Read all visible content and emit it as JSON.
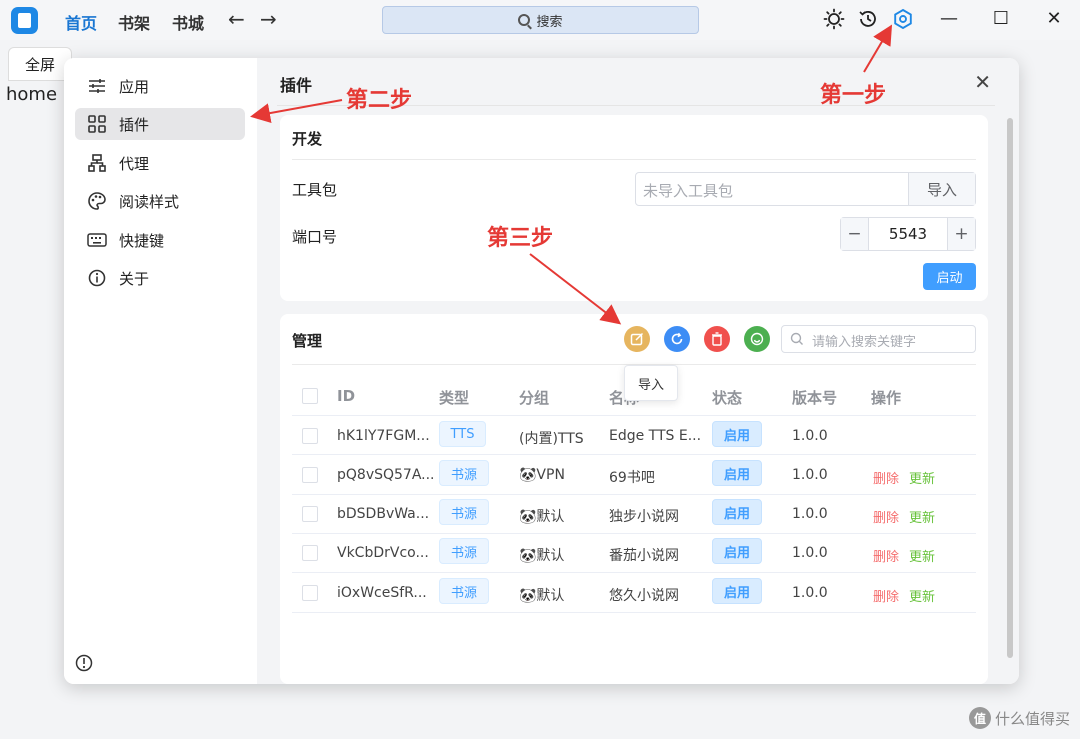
{
  "topbar": {
    "nav": [
      "首页",
      "书架",
      "书城"
    ],
    "back_arrow": "←",
    "forward_arrow": "→",
    "search_label": "搜索",
    "minimize": "—",
    "maximize": "☐",
    "close": "✕"
  },
  "background": {
    "tab_label": "全屏",
    "home_text": "home"
  },
  "sidebar": {
    "items": [
      {
        "label": "应用",
        "icon": "sliders-icon"
      },
      {
        "label": "插件",
        "icon": "grid-icon"
      },
      {
        "label": "代理",
        "icon": "network-icon"
      },
      {
        "label": "阅读样式",
        "icon": "palette-icon"
      },
      {
        "label": "快捷键",
        "icon": "keyboard-icon"
      },
      {
        "label": "关于",
        "icon": "info-icon"
      }
    ],
    "active_index": 1
  },
  "content": {
    "title": "插件",
    "close": "✕"
  },
  "dev_card": {
    "title": "开发",
    "toolkit_label": "工具包",
    "toolkit_placeholder": "未导入工具包",
    "import_button": "导入",
    "port_label": "端口号",
    "port_value": "5543",
    "minus": "−",
    "plus": "+",
    "start_button": "启动"
  },
  "manage_card": {
    "title": "管理",
    "search_placeholder": "请输入搜索关键字",
    "tooltip": "导入",
    "action_colors": [
      "#e6b55f",
      "#3d8df5",
      "#f0504d",
      "#4caf50"
    ],
    "columns": [
      "ID",
      "类型",
      "分组",
      "名称",
      "状态",
      "版本号",
      "操作"
    ],
    "rows": [
      {
        "id": "hK1lY7FGM...",
        "type": "TTS",
        "group": "(内置)TTS",
        "name": "Edge TTS E...",
        "status": "启用",
        "version": "1.0.0",
        "delete": "",
        "update": ""
      },
      {
        "id": "pQ8vSQ57A...",
        "type": "书源",
        "group": "🐼VPN",
        "name": "69书吧",
        "status": "启用",
        "version": "1.0.0",
        "delete": "删除",
        "update": "更新"
      },
      {
        "id": "bDSDBvWa...",
        "type": "书源",
        "group": "🐼默认",
        "name": "独步小说网",
        "status": "启用",
        "version": "1.0.0",
        "delete": "删除",
        "update": "更新"
      },
      {
        "id": "VkCbDrVco...",
        "type": "书源",
        "group": "🐼默认",
        "name": "番茄小说网",
        "status": "启用",
        "version": "1.0.0",
        "delete": "删除",
        "update": "更新"
      },
      {
        "id": "iOxWceSfR...",
        "type": "书源",
        "group": "🐼默认",
        "name": "悠久小说网",
        "status": "启用",
        "version": "1.0.0",
        "delete": "删除",
        "update": "更新"
      }
    ]
  },
  "annotations": {
    "step1": "第一步",
    "step2": "第二步",
    "step3": "第三步",
    "color": "#e53935"
  },
  "watermark": {
    "badge": "值",
    "text": "什么值得买"
  }
}
